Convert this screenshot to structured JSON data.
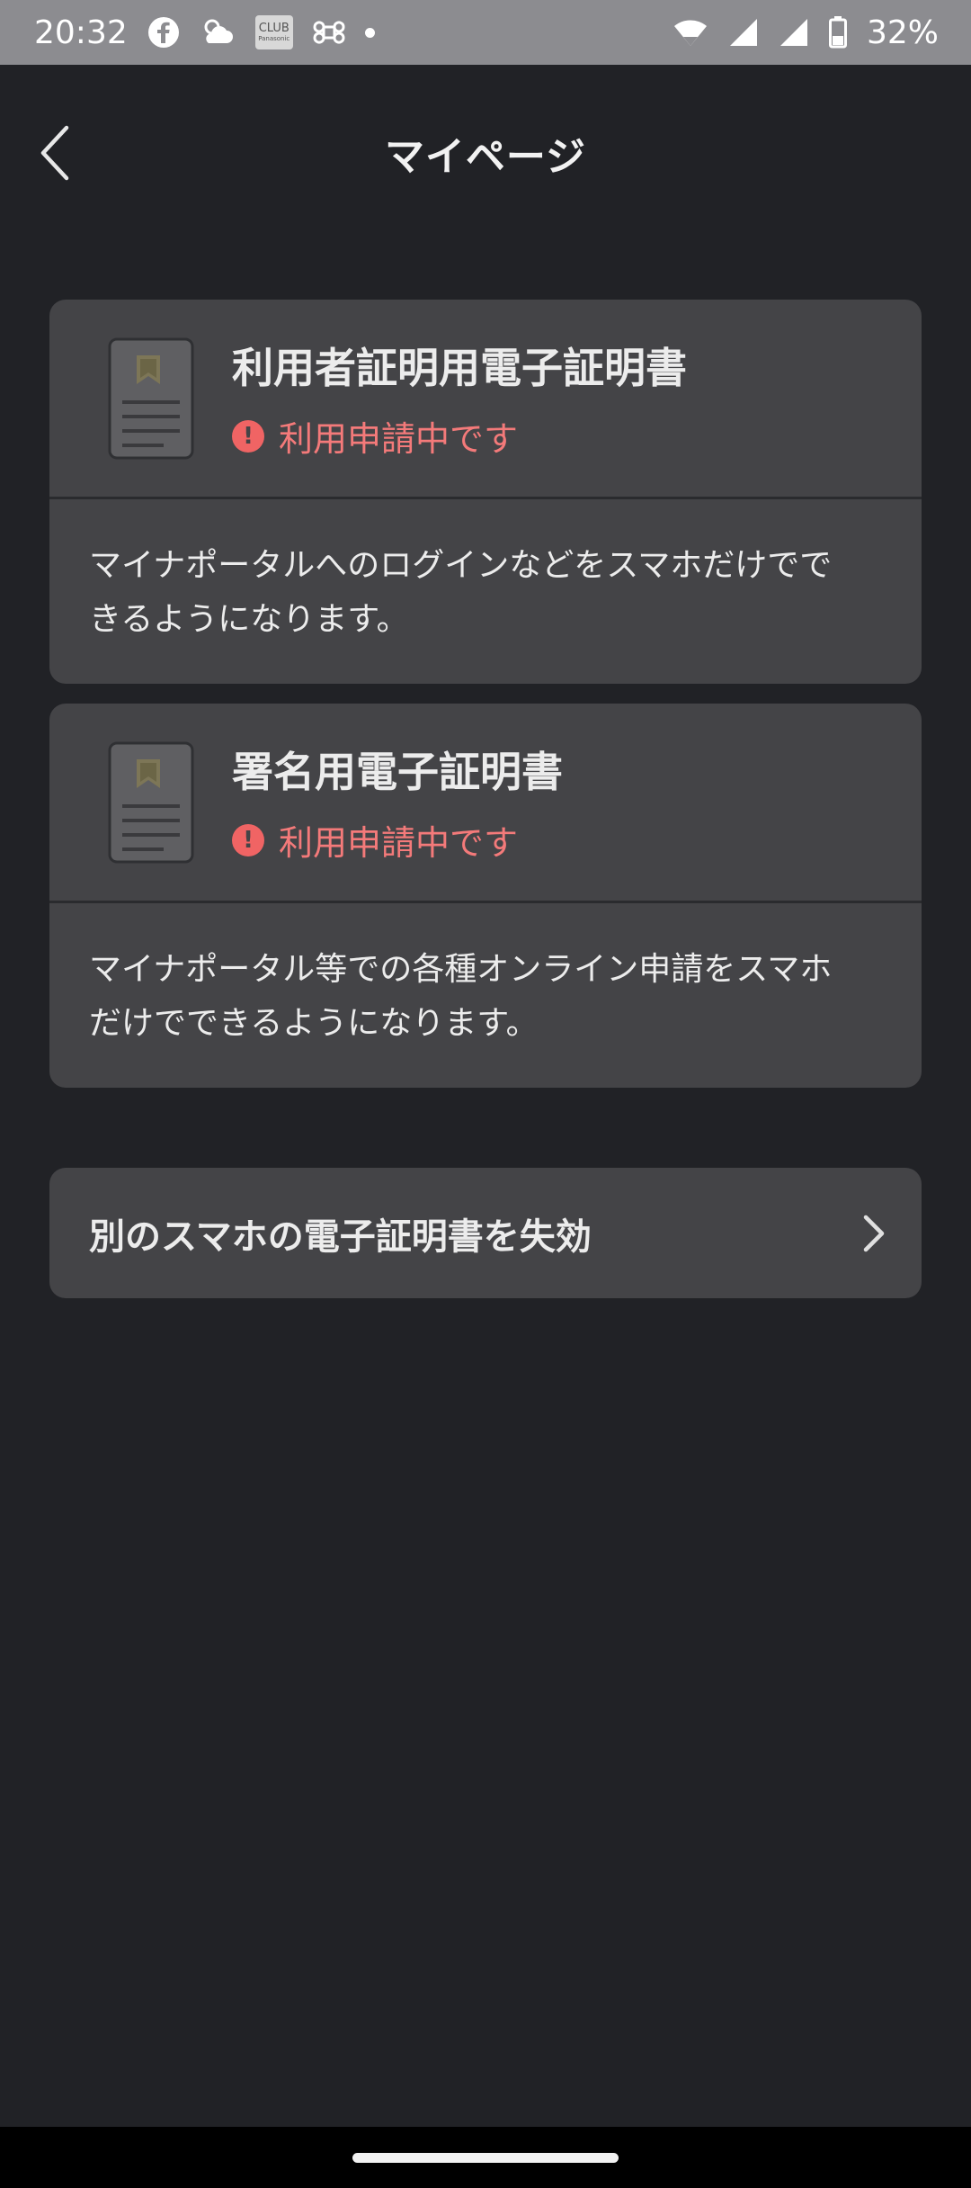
{
  "status_bar": {
    "time": "20:32",
    "icons": [
      "facebook-icon",
      "weather-icon",
      "club-panasonic-icon",
      "command-icon",
      "dot-icon"
    ],
    "club_badge_text": "CLUB",
    "club_badge_sub": "Panasonic",
    "right_icons": [
      "wifi-icon",
      "signal-icon",
      "signal-icon",
      "battery-icon"
    ],
    "battery": "32%"
  },
  "header": {
    "title": "マイページ",
    "back_icon": "chevron-left-icon"
  },
  "certificates": [
    {
      "title": "利用者証明用電子証明書",
      "status": "利用申請中です",
      "description": "マイナポータルへのログインなどをスマホだけでできるようになります。"
    },
    {
      "title": "署名用電子証明書",
      "status": "利用申請中です",
      "description": "マイナポータル等での各種オンライン申請をスマホだけでできるようになります。"
    }
  ],
  "alert_glyph": "!",
  "action": {
    "label": "別のスマホの電子証明書を失効",
    "icon": "chevron-right-icon"
  },
  "colors": {
    "background": "#212226",
    "card": "#444447",
    "status_red": "#f47a7a",
    "status_bar": "#8c8c90"
  }
}
